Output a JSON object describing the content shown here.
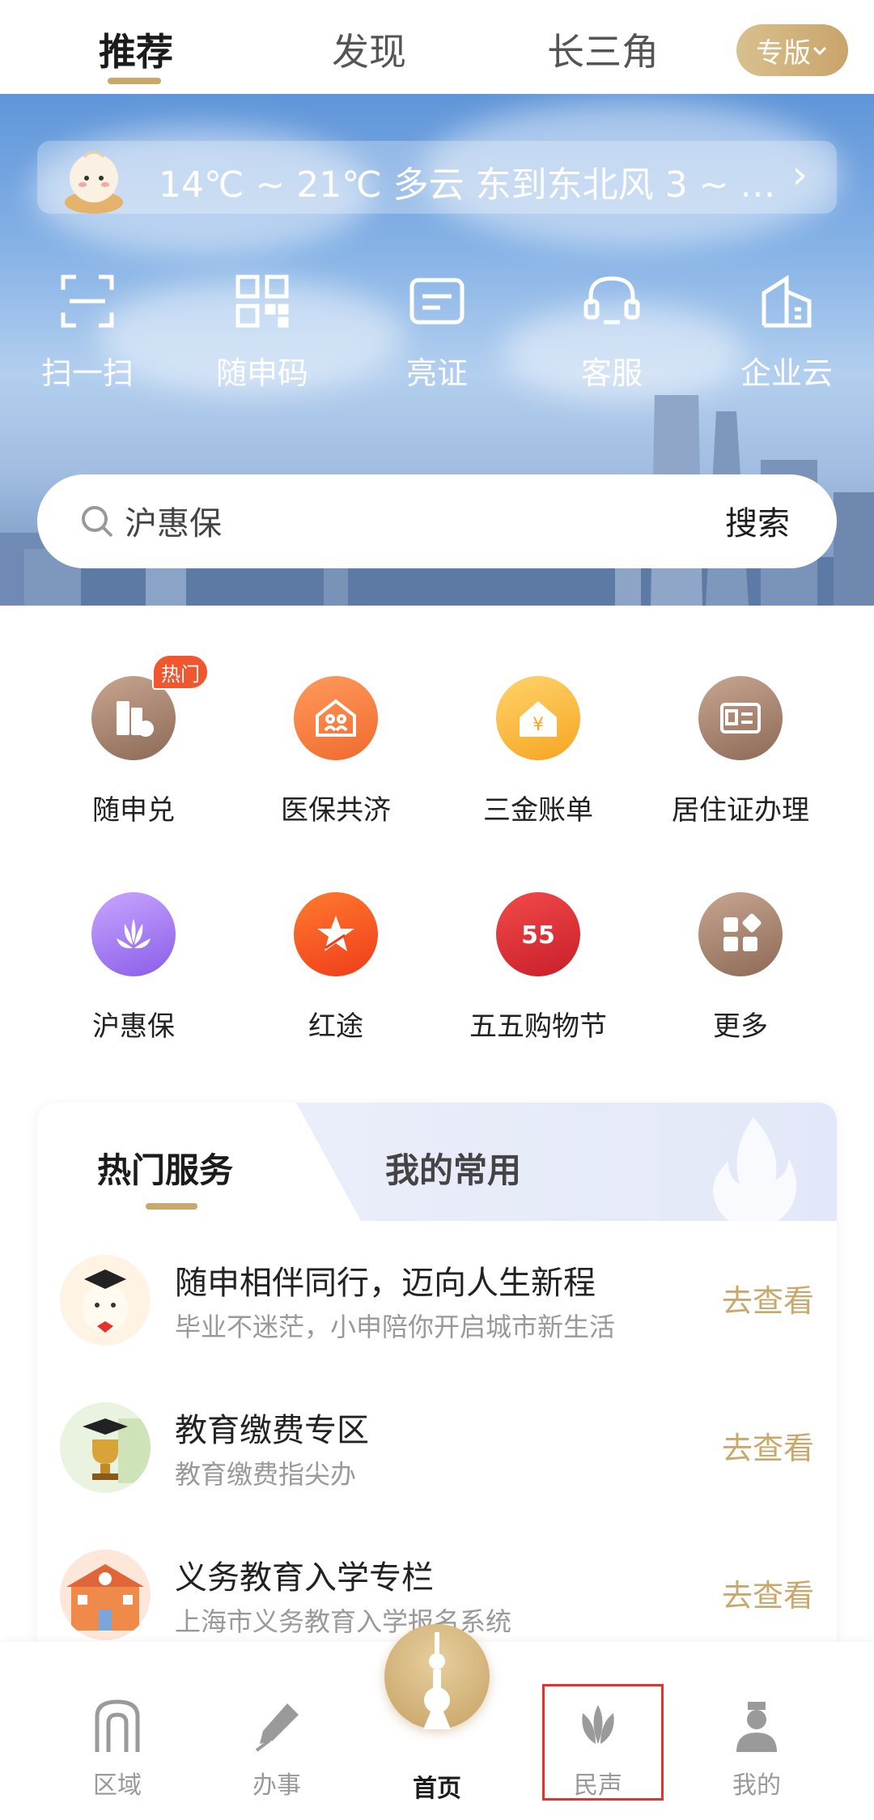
{
  "top_tabs": {
    "recommend": "推荐",
    "discover": "发现",
    "yangtze": "长三角",
    "edition": "专版"
  },
  "weather": {
    "text": "14℃ ~ 21℃  多云  东到东北风  3 ~ …"
  },
  "quick_actions": [
    {
      "label": "扫一扫",
      "icon": "scan-icon"
    },
    {
      "label": "随申码",
      "icon": "qrcode-icon"
    },
    {
      "label": "亮证",
      "icon": "id-card-icon"
    },
    {
      "label": "客服",
      "icon": "headset-icon"
    },
    {
      "label": "企业云",
      "icon": "building-icon"
    }
  ],
  "search": {
    "placeholder": "沪惠保",
    "button": "搜索"
  },
  "services": [
    {
      "label": "随申兑",
      "icon": "suishen-dui-icon",
      "badge": "热门"
    },
    {
      "label": "医保共济",
      "icon": "medical-insurance-icon"
    },
    {
      "label": "三金账单",
      "icon": "fund-bill-icon"
    },
    {
      "label": "居住证办理",
      "icon": "residence-permit-icon"
    },
    {
      "label": "沪惠保",
      "icon": "huhuibao-icon"
    },
    {
      "label": "红途",
      "icon": "red-route-icon"
    },
    {
      "label": "五五购物节",
      "icon": "shopping-festival-icon"
    },
    {
      "label": "更多",
      "icon": "more-icon"
    }
  ],
  "card": {
    "tab_hot": "热门服务",
    "tab_mine": "我的常用",
    "items": [
      {
        "title": "随申相伴同行，迈向人生新程",
        "subtitle": "毕业不迷茫，小申陪你开启城市新生活",
        "action": "去查看"
      },
      {
        "title": "教育缴费专区",
        "subtitle": "教育缴费指尖办",
        "action": "去查看"
      },
      {
        "title": "义务教育入学专栏",
        "subtitle": "上海市义务教育入学报名系统",
        "action": "去查看"
      }
    ]
  },
  "bottom_nav": {
    "region": "区域",
    "affairs": "办事",
    "home": "首页",
    "voice": "民声",
    "mine": "我的"
  },
  "colors": {
    "accent_gold": "#c9a86c",
    "hot_red": "#f0572f",
    "highlight": "#e5322d"
  }
}
